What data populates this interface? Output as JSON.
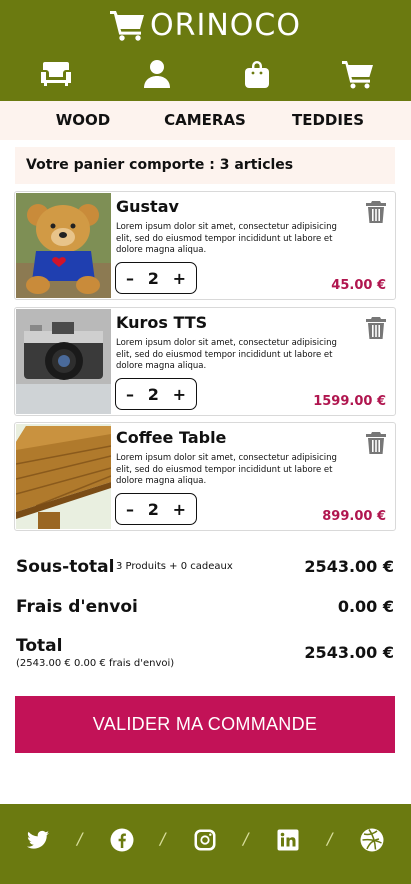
{
  "brand": {
    "name": "ORINOCO",
    "icon": "shopping-cart-icon"
  },
  "nav": [
    {
      "name": "sofa-icon"
    },
    {
      "name": "user-icon"
    },
    {
      "name": "shopping-bag-icon"
    },
    {
      "name": "shopping-cart-icon"
    }
  ],
  "categories": [
    "WOOD",
    "CAMERAS",
    "TEDDIES"
  ],
  "cart": {
    "summary": "Votre panier comporte : 3 articles",
    "items": [
      {
        "name": "Gustav",
        "desc": "Lorem ipsum dolor sit amet, consectetur adipisicing elit, sed do eiusmod tempor incididunt ut labore et dolore magna aliqua.",
        "qty": "2",
        "minus": "–",
        "plus": "+",
        "price": "45.00 €"
      },
      {
        "name": "Kuros TTS",
        "desc": "Lorem ipsum dolor sit amet, consectetur adipisicing elit, sed do eiusmod tempor incididunt ut labore et dolore magna aliqua.",
        "qty": "2",
        "minus": "–",
        "plus": "+",
        "price": "1599.00 €"
      },
      {
        "name": "Coffee Table",
        "desc": "Lorem ipsum dolor sit amet, consectetur adipisicing elit, sed do eiusmod tempor incididunt ut labore et dolore magna aliqua.",
        "qty": "2",
        "minus": "–",
        "plus": "+",
        "price": "899.00 €"
      }
    ]
  },
  "totals": {
    "subtotal_label": "Sous-total",
    "subtotal_note": "3 Produits + 0 cadeaux",
    "subtotal_value": "2543.00 €",
    "shipping_label": "Frais d'envoi",
    "shipping_value": "0.00 €",
    "total_label": "Total",
    "total_note": "(2543.00 € 0.00 € frais d'envoi)",
    "total_value": "2543.00 €"
  },
  "cta": {
    "label": "VALIDER MA COMMANDE"
  },
  "footer": {
    "social": [
      "twitter-icon",
      "facebook-icon",
      "instagram-icon",
      "linkedin-icon",
      "dribbble-icon"
    ],
    "separator": "/"
  },
  "colors": {
    "header": "#6b7a10",
    "accent": "#c21257",
    "price": "#b0164f",
    "soft": "#fdf3ee"
  }
}
